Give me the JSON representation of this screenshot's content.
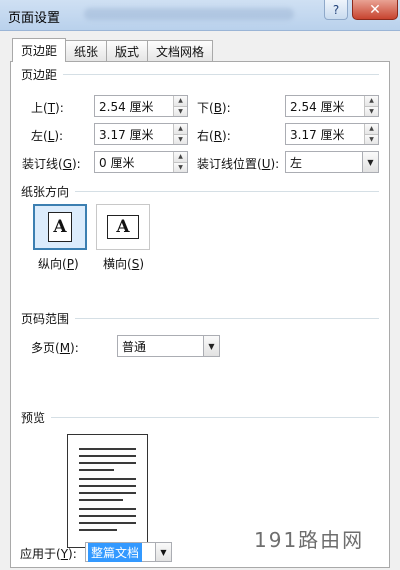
{
  "window": {
    "title": "页面设置",
    "close_glyph": "✕",
    "help_glyph": "?"
  },
  "tabs": [
    {
      "label": "页边距"
    },
    {
      "label": "纸张"
    },
    {
      "label": "版式"
    },
    {
      "label": "文档网格"
    }
  ],
  "margins": {
    "section_label": "页边距",
    "top": {
      "label": "上(",
      "key": "T",
      "suffix": "):",
      "value": "2.54 厘米"
    },
    "bottom": {
      "label": "下(",
      "key": "B",
      "suffix": "):",
      "value": "2.54 厘米"
    },
    "left": {
      "label": "左(",
      "key": "L",
      "suffix": "):",
      "value": "3.17 厘米"
    },
    "right": {
      "label": "右(",
      "key": "R",
      "suffix": "):",
      "value": "3.17 厘米"
    },
    "gutter": {
      "label": "装订线(",
      "key": "G",
      "suffix": "):",
      "value": "0 厘米"
    },
    "gutter_position": {
      "label": "装订线位置(",
      "key": "U",
      "suffix": "):",
      "value": "左"
    }
  },
  "orientation": {
    "section_label": "纸张方向",
    "glyph": "A",
    "portrait": {
      "label": "纵向(",
      "key": "P",
      "suffix": ")"
    },
    "landscape": {
      "label": "横向(",
      "key": "S",
      "suffix": ")"
    },
    "selected": "portrait"
  },
  "pages": {
    "section_label": "页码范围",
    "multiple": {
      "label": "多页(",
      "key": "M",
      "suffix": "):",
      "value": "普通"
    }
  },
  "preview": {
    "section_label": "预览"
  },
  "apply_to": {
    "label": "应用于(",
    "key": "Y",
    "suffix": "):",
    "value": "整篇文档"
  },
  "watermark": "191路由网",
  "colors": {
    "titlebar": "#cfe0f3",
    "close_button": "#c7442f",
    "selection": "#3399ff",
    "selected_orientation_border": "#3c7fb1"
  }
}
